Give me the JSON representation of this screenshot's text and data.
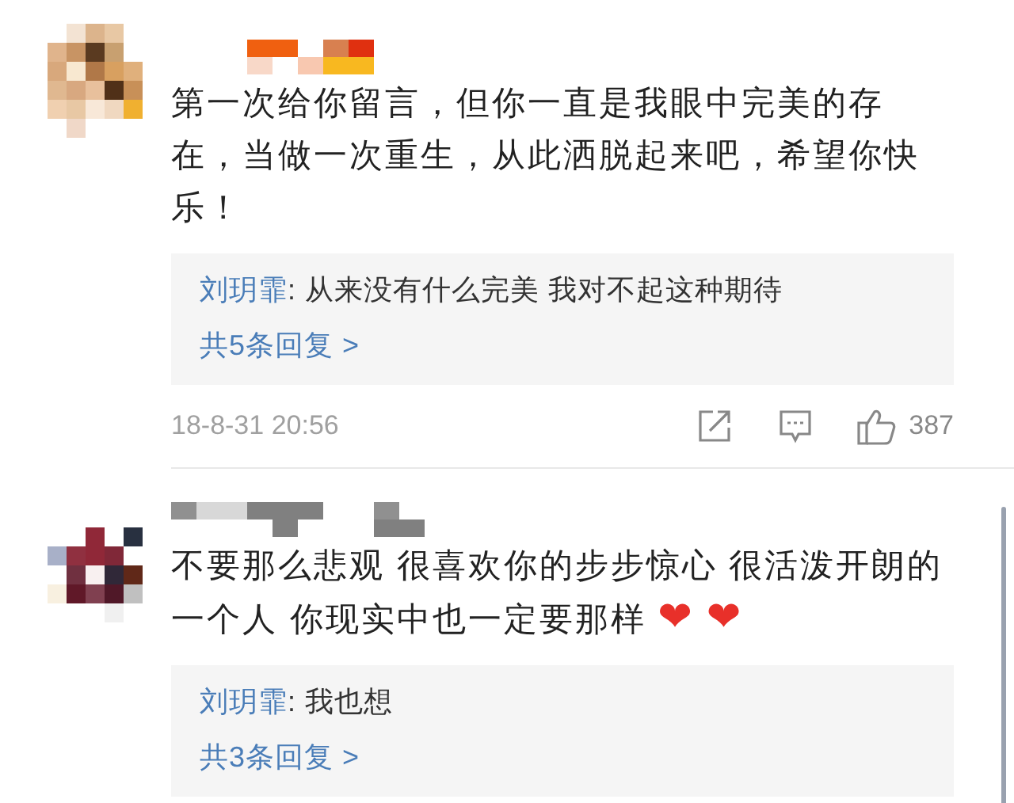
{
  "comments": [
    {
      "lines": [
        "第一次给你留言，但你一直是我眼中完美的存",
        "在，当做一次重生，从此洒脱起来吧，希望你快",
        "乐！"
      ],
      "reply": {
        "author": "刘玥霏",
        "text": ": 从来没有什么完美 我对不起这种期待"
      },
      "more_replies": "共5条回复 >",
      "time": "18-8-31 20:56",
      "likes": "387"
    },
    {
      "lines": [
        "不要那么悲观 很喜欢你的步步惊心 很活泼开朗的",
        "一个人 你现实中也一定要那样 ❤ ❤"
      ],
      "reply": {
        "author": "刘玥霏",
        "text": ": 我也想"
      },
      "more_replies": "共3条回复 >"
    }
  ]
}
